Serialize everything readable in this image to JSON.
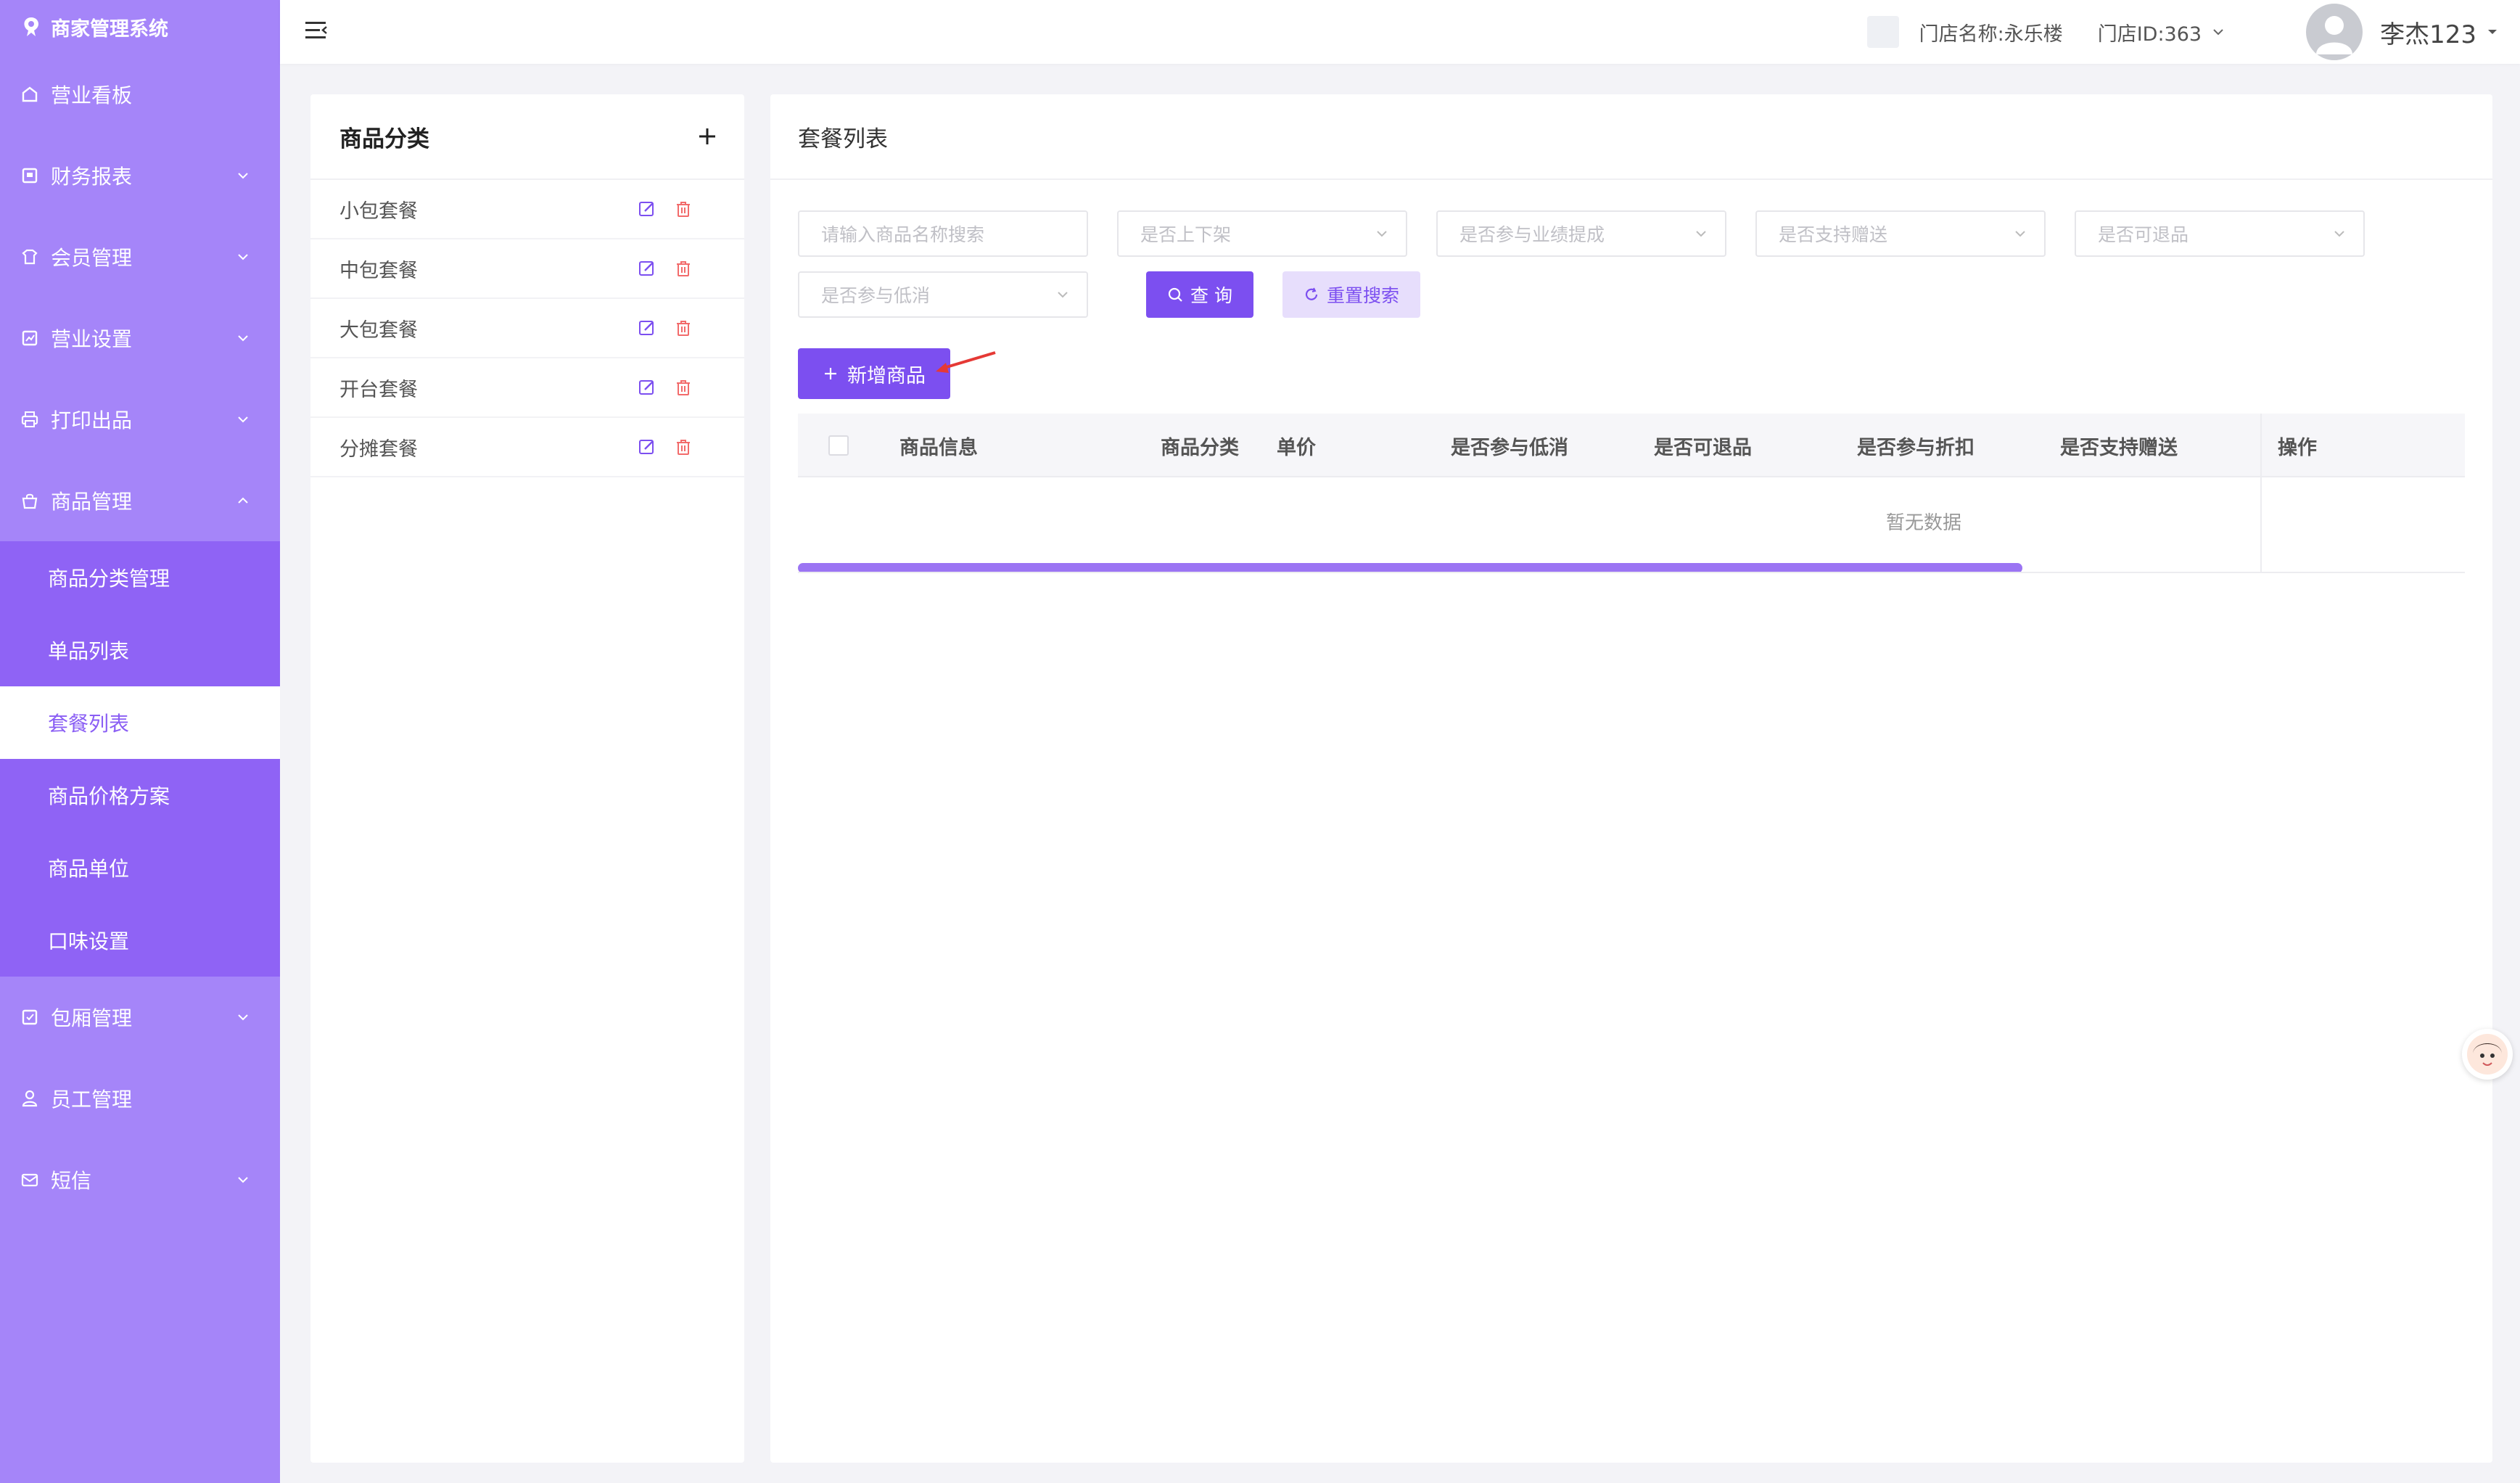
{
  "app": {
    "title": "商家管理系统"
  },
  "header": {
    "store_name": "门店名称:永乐楼",
    "store_id": "门店ID:363",
    "user_name": "李杰123"
  },
  "sidebar": {
    "items": [
      {
        "label": "营业看板",
        "icon": "dashboard-icon"
      },
      {
        "label": "财务报表",
        "icon": "report-icon"
      },
      {
        "label": "会员管理",
        "icon": "member-icon"
      },
      {
        "label": "营业设置",
        "icon": "settings-icon"
      },
      {
        "label": "打印出品",
        "icon": "printer-icon"
      },
      {
        "label": "商品管理",
        "icon": "shop-bag-icon"
      },
      {
        "label": "包厢管理",
        "icon": "room-icon"
      },
      {
        "label": "员工管理",
        "icon": "staff-icon"
      },
      {
        "label": "短信",
        "icon": "mail-icon"
      }
    ],
    "submenu": [
      {
        "label": "商品分类管理"
      },
      {
        "label": "单品列表"
      },
      {
        "label": "套餐列表",
        "active": true
      },
      {
        "label": "商品价格方案"
      },
      {
        "label": "商品单位"
      },
      {
        "label": "口味设置"
      }
    ]
  },
  "category_panel": {
    "title": "商品分类",
    "items": [
      "小包套餐",
      "中包套餐",
      "大包套餐",
      "开台套餐",
      "分摊套餐"
    ]
  },
  "main": {
    "title": "套餐列表",
    "filters": {
      "search_placeholder": "请输入商品名称搜索",
      "on_shelf": "是否上下架",
      "commission": "是否参与业绩提成",
      "gift": "是否支持赠送",
      "returnable": "是否可退品",
      "min_spend": "是否参与低消"
    },
    "buttons": {
      "query": "查 询",
      "reset": "重置搜索",
      "add": "新增商品"
    },
    "table": {
      "columns": [
        "商品信息",
        "商品分类",
        "单价",
        "是否参与低消",
        "是否可退品",
        "是否参与折扣",
        "是否支持赠送",
        "操作"
      ],
      "empty_text": "暂无数据"
    }
  },
  "colors": {
    "sidebar": "#a585f9",
    "submenu": "#8f63f5",
    "primary": "#7c4ff0",
    "delete": "#f26b6b"
  }
}
